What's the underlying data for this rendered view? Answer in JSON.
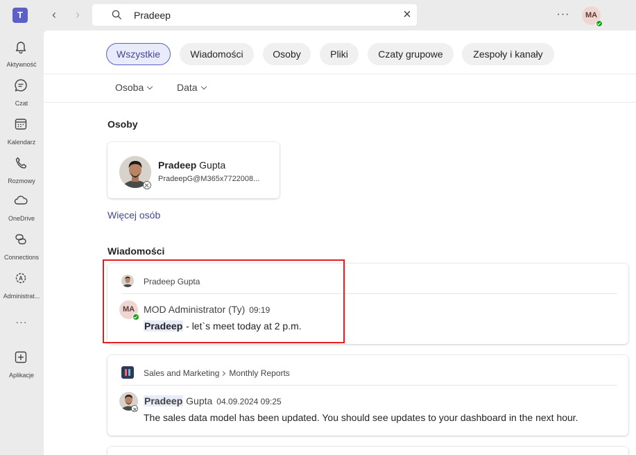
{
  "topbar": {
    "app_icon": "teams-logo-icon",
    "search_value": "Pradeep",
    "user_initials": "MA"
  },
  "rail": {
    "items": [
      {
        "label": "Aktywność",
        "icon": "bell-icon"
      },
      {
        "label": "Czat",
        "icon": "chat-icon"
      },
      {
        "label": "Kalendarz",
        "icon": "calendar-icon"
      },
      {
        "label": "Rozmowy",
        "icon": "phone-icon"
      },
      {
        "label": "OneDrive",
        "icon": "cloud-icon"
      },
      {
        "label": "Connections",
        "icon": "connections-icon"
      },
      {
        "label": "Administrat...",
        "icon": "admin-icon"
      },
      {
        "label": "Aplikacje",
        "icon": "add-apps-icon"
      }
    ],
    "more": "···"
  },
  "tabs": [
    "Wszystkie",
    "Wiadomości",
    "Osoby",
    "Pliki",
    "Czaty grupowe",
    "Zespoły i kanały"
  ],
  "active_tab": "Wszystkie",
  "filters": [
    "Osoba",
    "Data"
  ],
  "people": {
    "title": "Osoby",
    "card": {
      "first_name": "Pradeep",
      "last_name": " Gupta",
      "email": "PradeepG@M365x7722008..."
    },
    "more_link": "Więcej osób"
  },
  "messages": {
    "title": "Wiadomości",
    "items": [
      {
        "header": "Pradeep Gupta",
        "sender": "MOD Administrator (Ty)",
        "sender_initials": "MA",
        "time": "09:19",
        "highlight": "Pradeep",
        "text": " - let`s meet today at  2 p.m."
      },
      {
        "header_team": "Sales and Marketing",
        "header_channel": "Monthly Reports",
        "sender_highlight": "Pradeep",
        "sender_rest": " Gupta",
        "time": "04.09.2024 09:25",
        "text": "The sales data model has been updated. You should see updates to your dashboard in the next hour."
      }
    ]
  },
  "colors": {
    "accent": "#5b5fc7",
    "link": "#444791",
    "annotation_box": "#e02020",
    "presence_available": "#13a10e"
  }
}
